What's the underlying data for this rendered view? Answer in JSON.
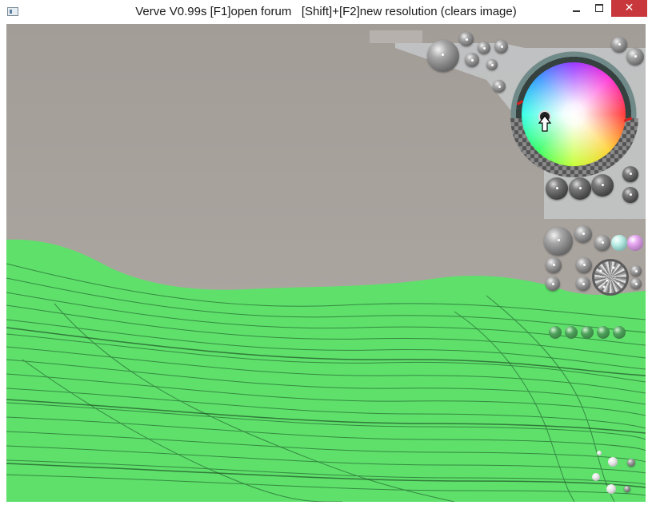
{
  "window": {
    "title": "Verve V0.99s [F1]open forum   [Shift]+[F2]new resolution (clears image)",
    "controls": {
      "minimize_icon": "minimize-icon",
      "maximize_icon": "maximize-icon",
      "close_glyph": "✕"
    }
  },
  "canvas": {
    "background_color": "#aaa49f",
    "paint_color": "#5ee06b"
  },
  "color_picker": {
    "icons": [
      "color-wheel",
      "saturation-ring",
      "alpha-checker",
      "color-cursor",
      "pointer-cursor"
    ]
  },
  "colors": {
    "close_button": "#c7373b",
    "panel_bg": "#c2c4c6",
    "panel_ring": "#6f8a88"
  }
}
